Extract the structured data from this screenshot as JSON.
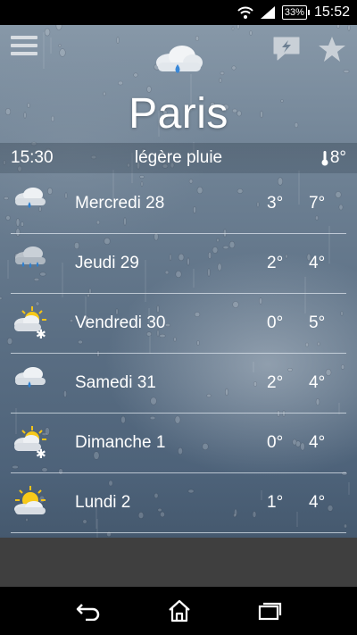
{
  "status_bar": {
    "battery": "33%",
    "time": "15:52",
    "icons": [
      "wifi-icon",
      "signal-icon",
      "battery-icon"
    ]
  },
  "header": {
    "menu_icon": "hamburger-menu-icon",
    "weather_icon": "cloud-rain-icon",
    "flash_icon": "lightning-chat-icon",
    "favorite_icon": "star-icon"
  },
  "current": {
    "city": "Paris",
    "time": "15:30",
    "description": "légère pluie",
    "temperature": "8°",
    "thermometer_icon": "thermometer-icon"
  },
  "forecast": [
    {
      "day": "Mercredi 28",
      "min": "3°",
      "max": "7°",
      "icon": "cloud-rain-icon"
    },
    {
      "day": "Jeudi 29",
      "min": "2°",
      "max": "4°",
      "icon": "cloud-heavy-rain-icon"
    },
    {
      "day": "Vendredi 30",
      "min": "0°",
      "max": "5°",
      "icon": "sun-cloud-snow-icon"
    },
    {
      "day": "Samedi 31",
      "min": "2°",
      "max": "4°",
      "icon": "cloud-rain-icon"
    },
    {
      "day": "Dimanche 1",
      "min": "0°",
      "max": "4°",
      "icon": "sun-cloud-snow-icon"
    },
    {
      "day": "Lundi 2",
      "min": "1°",
      "max": "4°",
      "icon": "sun-cloud-icon"
    }
  ],
  "nav_bar": {
    "icons": [
      "back-icon",
      "home-icon",
      "recent-apps-icon"
    ]
  },
  "colors": {
    "sky_top": "#8798a8",
    "sky_bottom": "#3f5266",
    "divider": "#dce4ec",
    "status_bar": "#000000",
    "gap_bar": "#3f3f3f"
  }
}
